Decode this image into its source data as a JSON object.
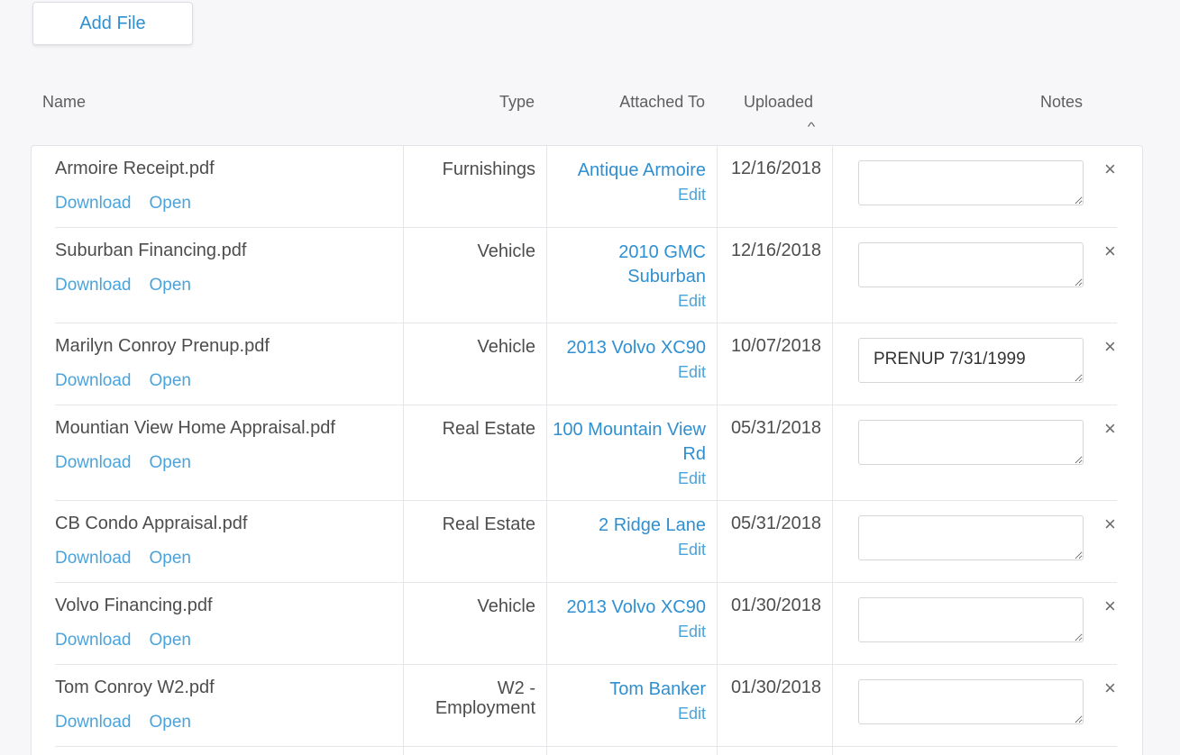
{
  "toolbar": {
    "add_file_label": "Add File"
  },
  "table": {
    "headers": {
      "name": "Name",
      "type": "Type",
      "attached_to": "Attached To",
      "uploaded": "Uploaded",
      "notes": "Notes"
    },
    "sort_indicator": "^",
    "actions": {
      "download": "Download",
      "open": "Open",
      "edit": "Edit",
      "delete": "×"
    },
    "rows": [
      {
        "name": "Armoire Receipt.pdf",
        "type": "Furnishings",
        "attached_to": "Antique Armoire",
        "uploaded": "12/16/2018",
        "notes": ""
      },
      {
        "name": "Suburban Financing.pdf",
        "type": "Vehicle",
        "attached_to": "2010 GMC Suburban",
        "uploaded": "12/16/2018",
        "notes": ""
      },
      {
        "name": "Marilyn Conroy Prenup.pdf",
        "type": "Vehicle",
        "attached_to": "2013 Volvo XC90",
        "uploaded": "10/07/2018",
        "notes": "PRENUP 7/31/1999"
      },
      {
        "name": "Mountian View Home Appraisal.pdf",
        "type": "Real Estate",
        "attached_to": "100 Mountain View Rd",
        "uploaded": "05/31/2018",
        "notes": ""
      },
      {
        "name": "CB Condo Appraisal.pdf",
        "type": "Real Estate",
        "attached_to": "2 Ridge Lane",
        "uploaded": "05/31/2018",
        "notes": ""
      },
      {
        "name": "Volvo Financing.pdf",
        "type": "Vehicle",
        "attached_to": "2013 Volvo XC90",
        "uploaded": "01/30/2018",
        "notes": ""
      },
      {
        "name": "Tom Conroy W2.pdf",
        "type": "W2 - Employment",
        "attached_to": "Tom Banker",
        "uploaded": "01/30/2018",
        "notes": ""
      }
    ]
  }
}
